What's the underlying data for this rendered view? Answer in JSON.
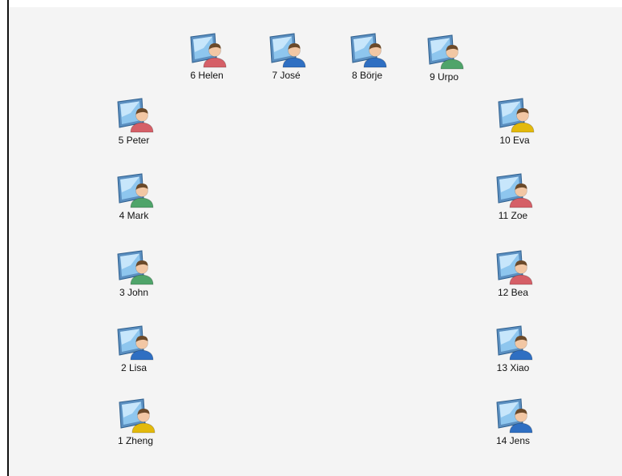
{
  "colors": {
    "panel_bg": "#f4f4f4",
    "border": "#111111",
    "shirt_red": "#d55f67",
    "shirt_blue": "#2f6fc2",
    "shirt_green": "#4fa46a",
    "shirt_yellow": "#e3b90c",
    "monitor": "#8ec6ee"
  },
  "stations": [
    {
      "id": 1,
      "label": "1 Zheng",
      "shirt": "yellow",
      "icon": "student-computer-icon"
    },
    {
      "id": 2,
      "label": "2 Lisa",
      "shirt": "blue",
      "icon": "student-computer-icon"
    },
    {
      "id": 3,
      "label": "3 John",
      "shirt": "green",
      "icon": "student-computer-icon"
    },
    {
      "id": 4,
      "label": "4 Mark",
      "shirt": "green",
      "icon": "student-computer-icon"
    },
    {
      "id": 5,
      "label": "5 Peter",
      "shirt": "red",
      "icon": "student-computer-icon"
    },
    {
      "id": 6,
      "label": "6 Helen",
      "shirt": "red",
      "icon": "student-computer-icon"
    },
    {
      "id": 7,
      "label": "7 José",
      "shirt": "blue",
      "icon": "student-computer-icon"
    },
    {
      "id": 8,
      "label": "8 Börje",
      "shirt": "blue",
      "icon": "student-computer-icon"
    },
    {
      "id": 9,
      "label": "9 Urpo",
      "shirt": "green",
      "icon": "student-computer-icon"
    },
    {
      "id": 10,
      "label": "10 Eva",
      "shirt": "yellow",
      "icon": "student-computer-icon"
    },
    {
      "id": 11,
      "label": "11 Zoe",
      "shirt": "red",
      "icon": "student-computer-icon"
    },
    {
      "id": 12,
      "label": "12 Bea",
      "shirt": "red",
      "icon": "student-computer-icon"
    },
    {
      "id": 13,
      "label": "13 Xiao",
      "shirt": "blue",
      "icon": "student-computer-icon"
    },
    {
      "id": 14,
      "label": "14 Jens",
      "shirt": "blue",
      "icon": "student-computer-icon"
    }
  ]
}
